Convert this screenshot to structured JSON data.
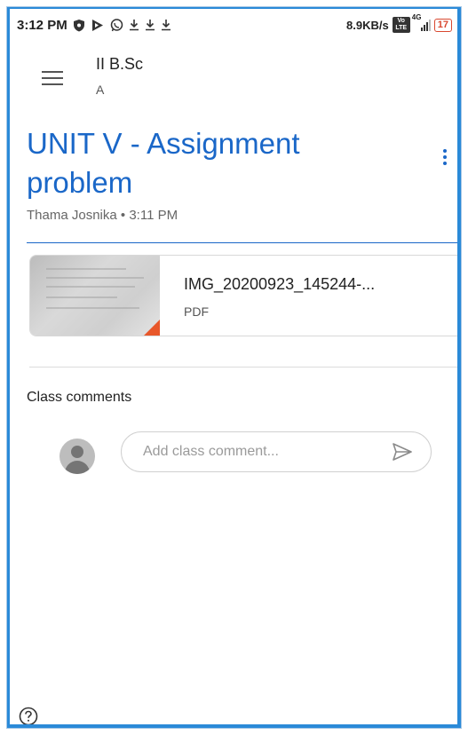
{
  "status_bar": {
    "time": "3:12 PM",
    "icons": [
      "shield-icon",
      "play-icon",
      "whatsapp-icon",
      "download-icon",
      "download-icon",
      "download-icon"
    ],
    "network_speed": "8.9KB/s",
    "volte_label": "Vo LTE",
    "network_type": "4G",
    "battery": "17"
  },
  "app_bar": {
    "class_name": "II B.Sc",
    "section": "A"
  },
  "post": {
    "title": "UNIT V - Assignment problem",
    "author": "Thama Josnika",
    "separator": "•",
    "time": "3:11 PM",
    "accent": "#1a67c8"
  },
  "attachment": {
    "name": "IMG_20200923_145244-...",
    "type": "PDF"
  },
  "comments": {
    "label": "Class comments",
    "placeholder": "Add class comment..."
  }
}
